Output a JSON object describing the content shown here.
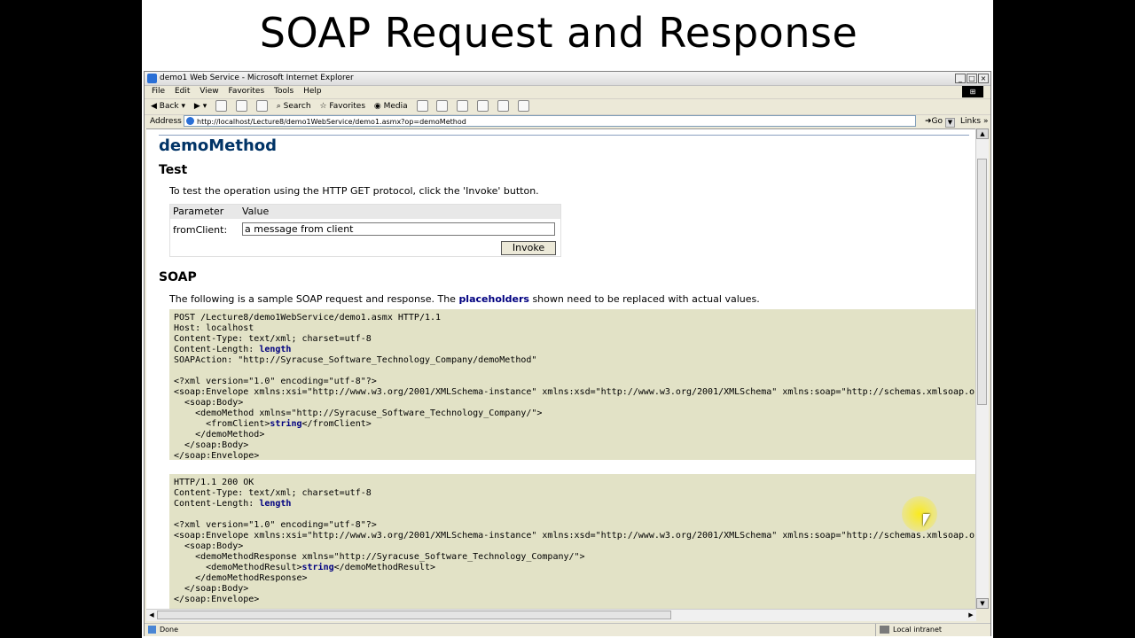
{
  "slide": {
    "title": "SOAP Request and Response"
  },
  "window": {
    "title": "demo1 Web Service - Microsoft Internet Explorer",
    "menu": [
      "File",
      "Edit",
      "View",
      "Favorites",
      "Tools",
      "Help"
    ],
    "toolbar": {
      "back": "Back",
      "search": "Search",
      "favorites": "Favorites",
      "media": "Media"
    },
    "address": {
      "label": "Address",
      "url": "http://localhost/Lecture8/demo1WebService/demo1.asmx?op=demoMethod",
      "go": "Go",
      "links": "Links"
    },
    "status": {
      "left": "Done",
      "right": "Local intranet"
    }
  },
  "page": {
    "method_title": "demoMethod",
    "test_heading": "Test",
    "test_text": "To test the operation using the HTTP GET protocol, click the 'Invoke' button.",
    "param_header": "Parameter",
    "value_header": "Value",
    "param_label": "fromClient:",
    "param_value": "a message from client",
    "invoke_label": "Invoke",
    "soap_heading": "SOAP",
    "soap_text_before": "The following is a sample SOAP request and response. The",
    "soap_text_link": "placeholders",
    "soap_text_after": "shown need to be replaced with actual values.",
    "request": {
      "l1": "POST /Lecture8/demo1WebService/demo1.asmx HTTP/1.1",
      "l2": "Host: localhost",
      "l3": "Content-Type: text/xml; charset=utf-8",
      "l4a": "Content-Length: ",
      "l4b": "length",
      "l5": "SOAPAction: \"http://Syracuse_Software_Technology_Company/demoMethod\"",
      "l7": "<?xml version=\"1.0\" encoding=\"utf-8\"?>",
      "l8": "<soap:Envelope xmlns:xsi=\"http://www.w3.org/2001/XMLSchema-instance\" xmlns:xsd=\"http://www.w3.org/2001/XMLSchema\" xmlns:soap=\"http://schemas.xmlsoap.org/soap/envelope/\">",
      "l9": "  <soap:Body>",
      "l10": "    <demoMethod xmlns=\"http://Syracuse_Software_Technology_Company/\">",
      "l11a": "      <fromClient>",
      "l11b": "string",
      "l11c": "</fromClient>",
      "l12": "    </demoMethod>",
      "l13": "  </soap:Body>",
      "l14": "</soap:Envelope>"
    },
    "response": {
      "l1": "HTTP/1.1 200 OK",
      "l2": "Content-Type: text/xml; charset=utf-8",
      "l3a": "Content-Length: ",
      "l3b": "length",
      "l5": "<?xml version=\"1.0\" encoding=\"utf-8\"?>",
      "l6": "<soap:Envelope xmlns:xsi=\"http://www.w3.org/2001/XMLSchema-instance\" xmlns:xsd=\"http://www.w3.org/2001/XMLSchema\" xmlns:soap=\"http://schemas.xmlsoap.org/soap/envelope/\">",
      "l7": "  <soap:Body>",
      "l8": "    <demoMethodResponse xmlns=\"http://Syracuse_Software_Technology_Company/\">",
      "l9a": "      <demoMethodResult>",
      "l9b": "string",
      "l9c": "</demoMethodResult>",
      "l10": "    </demoMethodResponse>",
      "l11": "  </soap:Body>",
      "l12": "</soap:Envelope>"
    }
  },
  "colors": {
    "heading": "#003366",
    "placeholder": "#000080",
    "code_bg": "#e2e2c6"
  }
}
